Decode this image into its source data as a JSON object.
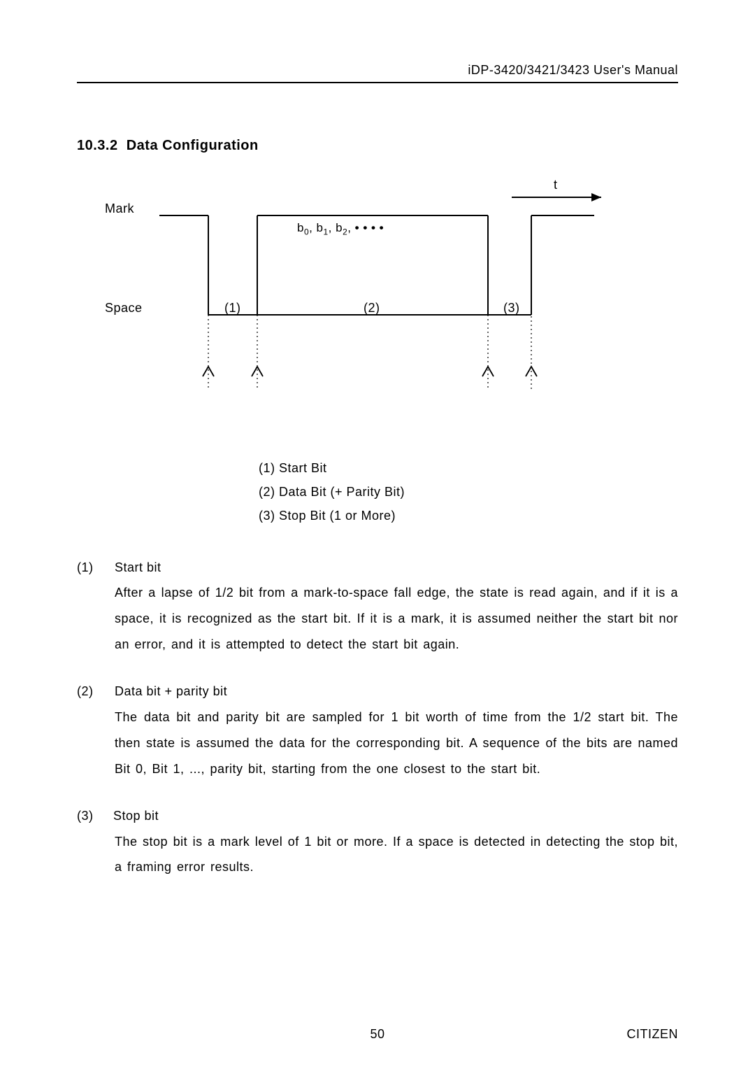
{
  "header": {
    "title": "iDP-3420/3421/3423 User's Manual"
  },
  "section": {
    "number": "10.3.2",
    "title": "Data Configuration"
  },
  "diagram": {
    "t_label": "t",
    "mark_label": "Mark",
    "space_label": "Space",
    "bits_label_prefix": "b",
    "bits_label_dots": "• • • •",
    "region1": "(1)",
    "region2": "(2)",
    "region3": "(3)",
    "legend": [
      "(1) Start Bit",
      "(2) Data Bit (+ Parity Bit)",
      "(3) Stop Bit (1 or More)"
    ]
  },
  "sections": {
    "s1": {
      "num": "(1)",
      "title": "Start bit",
      "body": "After a lapse of 1/2 bit from a mark-to-space fall edge, the state is read again, and if it is a space, it is recognized as the start bit.   If it is a mark, it is assumed neither the start bit nor an error, and it is attempted to detect the start bit again."
    },
    "s2": {
      "num": "(2)",
      "title": "Data bit + parity bit",
      "body": "The data bit and parity bit are sampled for 1 bit worth of time from the 1/2 start bit. The then state is assumed the data for the corresponding bit.   A sequence of the bits are named Bit 0, Bit 1, ..., parity bit, starting from the one closest to the start bit."
    },
    "s3": {
      "num": "(3)",
      "title": "Stop bit",
      "body": "The stop bit is a mark level of 1 bit or more.   If a space is detected in detecting the stop bit, a framing error results."
    }
  },
  "footer": {
    "page": "50",
    "brand": "CITIZEN"
  }
}
